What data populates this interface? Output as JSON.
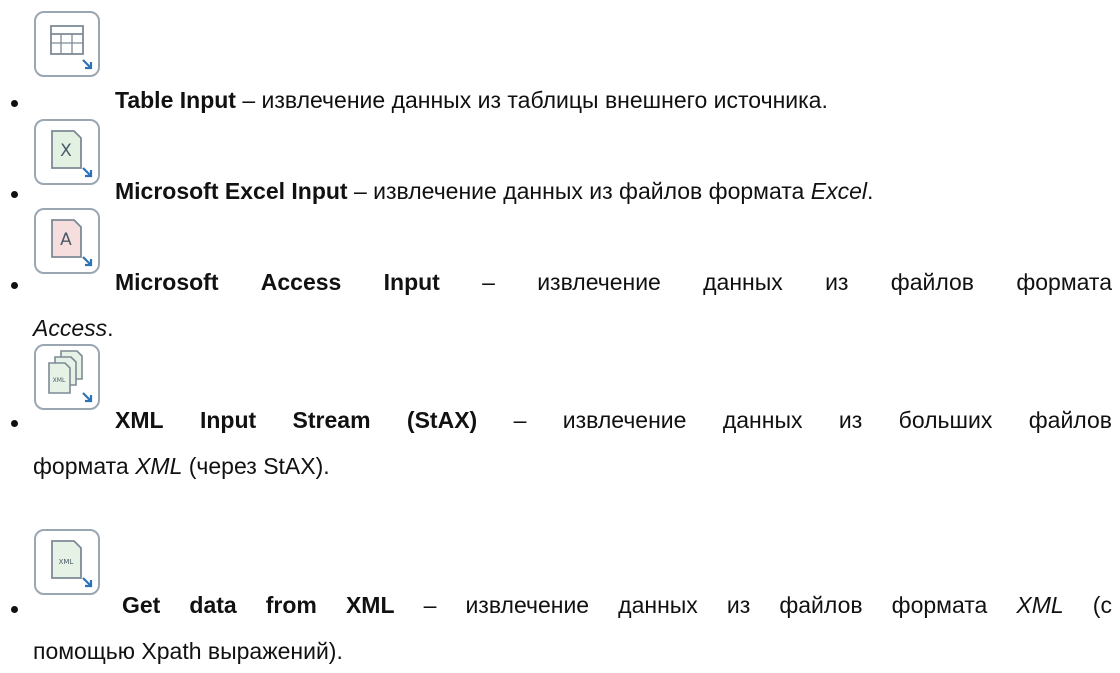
{
  "items": [
    {
      "icon": "table-input-icon",
      "name": "Table Input",
      "text": "– извлечение данных из таблицы внешнего источника."
    },
    {
      "icon": "excel-input-icon",
      "name": "Microsoft Excel Input",
      "text": "– извлечение данных из файлов формата ",
      "fmt": "Excel",
      "end": "."
    },
    {
      "icon": "access-input-icon",
      "name": "Microsoft Access Input",
      "words": [
        "Microsoft",
        "Access",
        "Input",
        "–",
        "извлечение",
        "данных",
        "из",
        "файлов",
        "формата"
      ],
      "cont_fmt": "Access",
      "cont_end": "."
    },
    {
      "icon": "xml-stream-icon",
      "name": "XML Input Stream (StAX)",
      "words": [
        "XML",
        "Input",
        "Stream",
        "(StAX)",
        "–",
        "извлечение",
        "данных",
        "из",
        "больших",
        "файлов"
      ],
      "cont_pre": "формата ",
      "cont_fmt": "XML",
      "cont_end": " (через StAX)."
    },
    {
      "icon": "xml-get-data-icon",
      "name": "Get data from XML",
      "words": [
        "Get",
        "data",
        "from",
        "XML",
        "–",
        "извлечение",
        "данных",
        "из",
        "файлов",
        "формата",
        "XML",
        "(с"
      ],
      "cont": "помощью Xpath выражений)."
    }
  ]
}
